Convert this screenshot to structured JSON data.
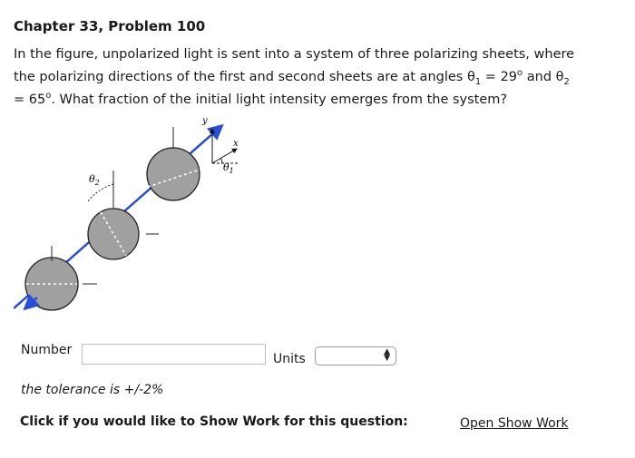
{
  "header": {
    "title": "Chapter 33, Problem 100"
  },
  "problem": {
    "line1": "In the figure, unpolarized light is sent into a system of three polarizing sheets, where",
    "line2_a": "the polarizing directions of the first and second sheets are at angles θ",
    "sub1": "1",
    "line2_b": " = 29",
    "sup1": "o",
    "line2_c": " and θ",
    "sub2": "2",
    "line3_a": "= 65",
    "sup2": "o",
    "line3_b": ". What fraction of the initial light intensity emerges from the system?"
  },
  "figure": {
    "theta1_label": "θ",
    "theta1_sub": "1",
    "theta2_label": "θ",
    "theta2_sub": "2",
    "x_label": "x",
    "y_label": "y"
  },
  "answer": {
    "number_label": "Number",
    "number_value": "",
    "units_label": "Units",
    "units_value": ""
  },
  "tolerance": "the tolerance is +/-2%",
  "show_work": {
    "label": "Click if you would like to Show Work for this question:",
    "link": "Open Show Work"
  },
  "colors": {
    "sheet_fill": "#a0a0a0",
    "beam": "#2a4fd6"
  },
  "icons": {
    "select_arrows": "updown-arrows-icon"
  }
}
